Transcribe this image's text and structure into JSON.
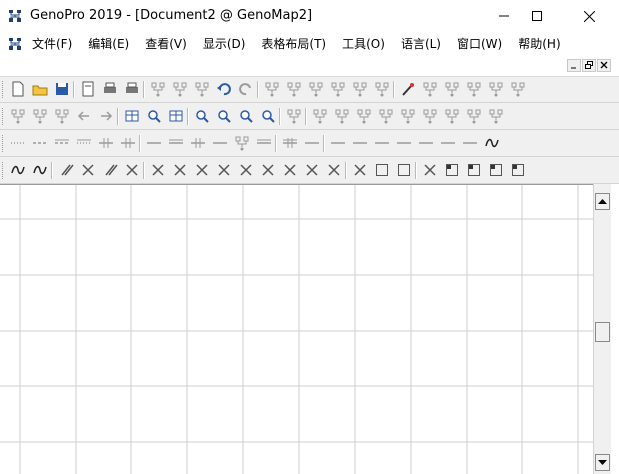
{
  "window": {
    "title": "GenoPro 2019 - [Document2 @ GenoMap2]",
    "app_icon": "genopro-tree-icon",
    "controls": [
      "minimize-icon",
      "maximize-icon",
      "close-icon"
    ]
  },
  "menubar": {
    "items": [
      {
        "label": "文件(F)"
      },
      {
        "label": "编辑(E)"
      },
      {
        "label": "查看(V)"
      },
      {
        "label": "显示(D)"
      },
      {
        "label": "表格布局(T)"
      },
      {
        "label": "工具(O)"
      },
      {
        "label": "语言(L)"
      },
      {
        "label": "窗口(W)"
      },
      {
        "label": "帮助(H)"
      }
    ]
  },
  "mdi_controls": [
    "mdi-minimize-icon",
    "mdi-restore-icon",
    "mdi-close-icon"
  ],
  "toolbars": {
    "row1": [
      "new-document-icon",
      "open-folder-icon",
      "save-icon",
      "page-setup-icon",
      "print-preview-icon",
      "print-icon",
      "cut-icon",
      "copy-icon",
      "paste-icon",
      "undo-icon",
      "redo-icon",
      "new-item-icon",
      "properties-icon",
      "family-tree-1-icon",
      "family-tree-2-icon",
      "family-tree-3-icon",
      "family-tree-4-icon",
      "magic-wand-icon",
      "relation-1-icon",
      "relation-2-icon",
      "relation-3-icon",
      "relation-4-icon",
      "relation-5-icon"
    ],
    "row2": [
      "link-icon",
      "link-2-icon",
      "link-3-icon",
      "arrow-left-icon",
      "arrow-right-icon",
      "table-icon",
      "find-icon",
      "report-icon",
      "zoom-in-icon",
      "zoom-out-icon",
      "zoom-box-icon",
      "zoom-fit-icon",
      "rotate-icon",
      "tree-a-icon",
      "tree-b-icon",
      "tree-c-icon",
      "tree-d-icon",
      "tree-e-icon",
      "tree-f-icon",
      "tree-g-icon",
      "tree-h-icon",
      "tree-i-icon"
    ],
    "row3": [
      "dotted-line-icon",
      "dashed-line-icon",
      "double-dash-icon",
      "double-dot-icon",
      "cross-line-icon",
      "cross-2-icon",
      "single-line-icon",
      "double-line-icon",
      "hash-line-icon",
      "circle-line-icon",
      "circle-2-icon",
      "triple-line-icon",
      "triple-hash-icon",
      "curve-icon",
      "curve-2-icon",
      "hatch-icon",
      "hatch-2-icon",
      "zigzag-icon",
      "zigzag-2-icon",
      "grid-icon",
      "grid-2-icon",
      "wave-arrow-icon"
    ],
    "row4": [
      "wave-icon",
      "double-wave-icon",
      "slash-icon",
      "x-icon",
      "double-slash-icon",
      "double-x-icon",
      "half-left-box-icon",
      "half-bottom-box-icon",
      "half-top-box-icon",
      "quarter-box-icon",
      "quarter-2-box-icon",
      "half-right-box-icon",
      "split-box-icon",
      "split-2-box-icon",
      "split-3-box-icon",
      "empty-box-icon",
      "empty-box-2-icon",
      "empty-box-3-icon",
      "corner-box-icon",
      "corner-box-2-icon",
      "corner-box-3-icon",
      "corner-box-4-icon",
      "corner-box-5-icon"
    ]
  },
  "colors": {
    "toolbar_bg": "#f0f0f0",
    "grid_line": "#cfcfcf",
    "icon_blue": "#2b5aa8",
    "icon_gray": "#9a9a9a"
  }
}
